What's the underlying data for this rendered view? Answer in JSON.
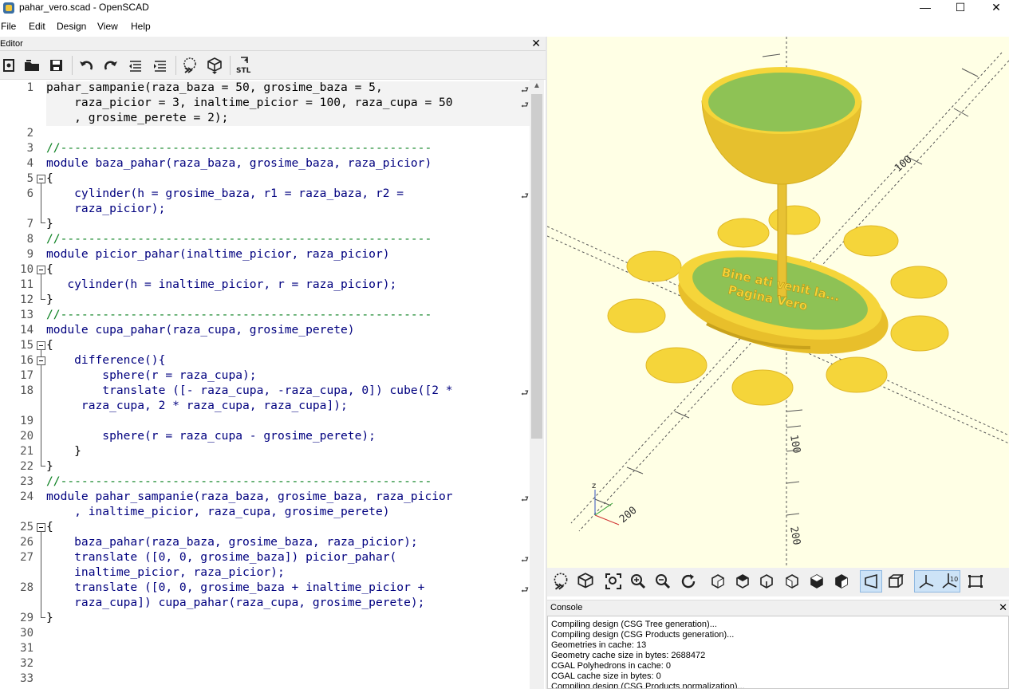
{
  "window": {
    "title": "pahar_vero.scad - OpenSCAD",
    "minimize": "—",
    "maximize": "☐",
    "close": "✕"
  },
  "menu": [
    "File",
    "Edit",
    "Design",
    "View",
    "Help"
  ],
  "editor": {
    "title": "Editor",
    "close": "✕",
    "toolbar": [
      "new-icon",
      "open-icon",
      "save-icon",
      "undo-icon",
      "redo-icon",
      "unindent-icon",
      "indent-icon",
      "preview-icon",
      "render-icon",
      "export-stl-icon"
    ],
    "stl_label": "STL",
    "line_numbers": [
      "1",
      "2",
      "3",
      "4",
      "5",
      "6",
      "7",
      "8",
      "9",
      "10",
      "11",
      "12",
      "13",
      "14",
      "15",
      "16",
      "17",
      "18",
      "19",
      "20",
      "21",
      "22",
      "23",
      "24",
      "25",
      "26",
      "27",
      "28",
      "29",
      "30",
      "31",
      "32",
      "33"
    ],
    "code": [
      "pahar_sampanie(raza_baza = 50, grosime_baza = 5,",
      "    raza_picior = 3, inaltime_picior = 100, raza_cupa = 50",
      "    , grosime_perete = 2);",
      "",
      "//-----------------------------------------------------",
      "module baza_pahar(raza_baza, grosime_baza, raza_picior)",
      "{",
      "    cylinder(h = grosime_baza, r1 = raza_baza, r2 =",
      "    raza_picior);",
      "}",
      "//-----------------------------------------------------",
      "module picior_pahar(inaltime_picior, raza_picior)",
      "{",
      "   cylinder(h = inaltime_picior, r = raza_picior);",
      "}",
      "//-----------------------------------------------------",
      "module cupa_pahar(raza_cupa, grosime_perete)",
      "{",
      "    difference(){",
      "        sphere(r = raza_cupa);",
      "        translate ([- raza_cupa, -raza_cupa, 0]) cube([2 *",
      "     raza_cupa, 2 * raza_cupa, raza_cupa]);",
      "",
      "        sphere(r = raza_cupa - grosime_perete);",
      "    }",
      "}",
      "//-----------------------------------------------------",
      "module pahar_sampanie(raza_baza, grosime_baza, raza_picior",
      "    , inaltime_picior, raza_cupa, grosime_perete)",
      "{",
      "    baza_pahar(raza_baza, grosime_baza, raza_picior);",
      "    translate ([0, 0, grosime_baza]) picior_pahar(",
      "    inaltime_picior, raza_picior);",
      "    translate ([0, 0, grosime_baza + inaltime_picior +",
      "    raza_cupa]) cupa_pahar(raza_cupa, grosime_perete);",
      "}"
    ]
  },
  "viewport": {
    "model_text_line1": "Bine ati venit la...",
    "model_text_line2": "Pagina Vero",
    "axis_z": "z",
    "ruler_labels": [
      "100",
      "200",
      "100",
      "200"
    ],
    "colors": {
      "background": "#ffffe5",
      "model": "#f5d53a",
      "model_inner": "#8ec255",
      "axes": "#555555"
    }
  },
  "view_toolbar": [
    "preview-icon",
    "render-icon",
    "view-all-icon",
    "zoom-in-icon",
    "zoom-out-icon",
    "reset-view-icon",
    "view-right-icon",
    "view-top-icon",
    "view-bottom-icon",
    "view-left-icon",
    "view-front-icon",
    "view-back-icon",
    "perspective-icon",
    "orthogonal-icon",
    "show-axes-icon",
    "show-scale-icon",
    "show-edges-icon"
  ],
  "console": {
    "title": "Console",
    "close": "✕",
    "lines": [
      "Compiling design (CSG Tree generation)...",
      "Compiling design (CSG Products generation)...",
      "Geometries in cache: 13",
      "Geometry cache size in bytes: 2688472",
      "CGAL Polyhedrons in cache: 0",
      "CGAL cache size in bytes: 0",
      "Compiling design (CSG Products normalization)..."
    ]
  }
}
